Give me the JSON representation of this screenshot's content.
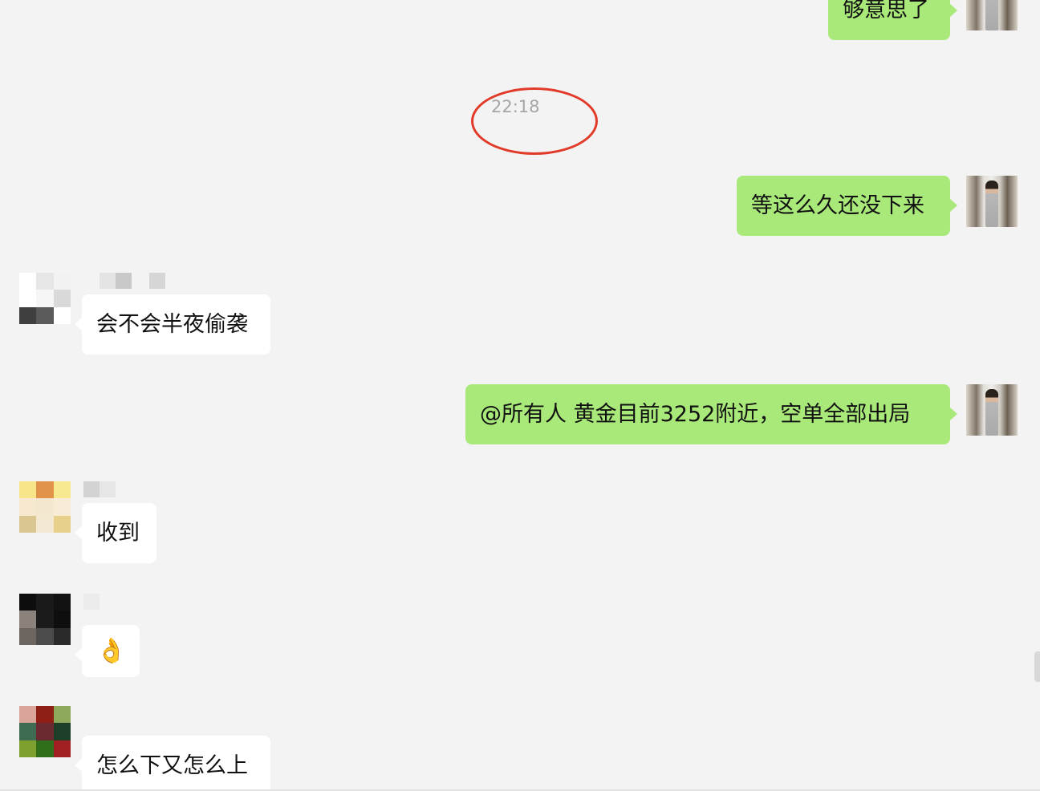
{
  "messages": [
    {
      "id": "m1",
      "direction": "outgoing",
      "text": "够意思了"
    },
    {
      "id": "m2",
      "direction": "outgoing",
      "text": "等这么久还没下来"
    },
    {
      "id": "m3",
      "direction": "incoming",
      "text": "会不会半夜偷袭"
    },
    {
      "id": "m4",
      "direction": "outgoing",
      "text": "@所有人 黄金目前3252附近，空单全部出局"
    },
    {
      "id": "m5",
      "direction": "incoming",
      "text": "收到"
    },
    {
      "id": "m6",
      "direction": "incoming",
      "text": "👌"
    },
    {
      "id": "m7",
      "direction": "incoming",
      "text": "怎么下又怎么上"
    }
  ],
  "timestamp": "22:18",
  "colors": {
    "background": "#f3f3f3",
    "outgoing_bubble": "#a9e97a",
    "incoming_bubble": "#ffffff",
    "highlight_circle": "#e23a28",
    "timestamp_text": "#a6a6a6"
  },
  "icons": {
    "self_avatar": "user-photo-avatar",
    "other_avatars": "pixelated-avatar-icon"
  }
}
